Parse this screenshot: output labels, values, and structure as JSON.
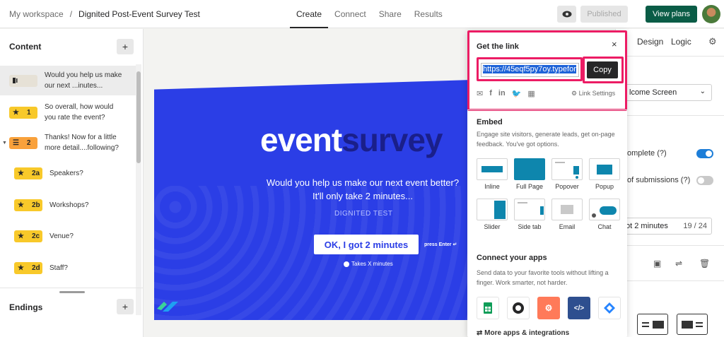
{
  "topbar": {
    "workspace": "My workspace",
    "separator": "/",
    "form_title": "Dignited Post-Event Survey Test",
    "tabs": [
      "Create",
      "Connect",
      "Share",
      "Results"
    ],
    "published_label": "Published",
    "view_plans_label": "View plans",
    "brand_color": "#0a5c46"
  },
  "sidebar": {
    "content_heading": "Content",
    "endings_heading": "Endings",
    "add_label": "+",
    "questions": [
      {
        "badge": "",
        "type": "welcome",
        "text": "Would you help us make our next ...inutes..."
      },
      {
        "badge": "1",
        "type": "star",
        "text": "So overall, how would you rate the event?"
      },
      {
        "badge": "2",
        "type": "group",
        "text": "Thanks! Now for a little more detail....following?"
      },
      {
        "badge": "2a",
        "type": "star",
        "text": "Speakers?"
      },
      {
        "badge": "2b",
        "type": "star",
        "text": "Workshops?"
      },
      {
        "badge": "2c",
        "type": "star",
        "text": "Venue?"
      },
      {
        "badge": "2d",
        "type": "star",
        "text": "Staff?"
      }
    ]
  },
  "canvas": {
    "logo_word1": "event",
    "logo_word2": "survey",
    "question_line1": "Would you help us make our next event better?",
    "question_line2": "It'll only take 2 minutes...",
    "subtitle": "DIGNITED TEST",
    "button_label": "OK, I got 2 minutes",
    "press_enter": "press Enter ↵",
    "takes_time": "Takes X minutes",
    "background_color": "#2b3ee6"
  },
  "right_panel": {
    "tab_design": "Design",
    "tab_logic": "Logic",
    "select_value": "lcome Screen",
    "toggle1_label": "omplete (?)",
    "toggle2_label": "of submissions (?)",
    "field_value": "ot 2 minutes",
    "field_count": "19 / 24"
  },
  "popover": {
    "title": "Get the link",
    "close": "×",
    "link_value": "https://45eqf5py7oy.typefor",
    "copy_label": "Copy",
    "link_settings": "Link Settings",
    "embed_title": "Embed",
    "embed_desc": "Engage site visitors, generate leads, get on-page feedback. You've got options.",
    "embed_options": [
      "Inline",
      "Full Page",
      "Popover",
      "Popup",
      "Slider",
      "Side tab",
      "Email",
      "Chat"
    ],
    "apps_title": "Connect your apps",
    "apps_desc": "Send data to your favorite tools without lifting a finger. Work smarter, not harder.",
    "apps": [
      "google-sheets-icon",
      "mailchimp-icon",
      "hubspot-icon",
      "embed-code-icon",
      "jira-icon"
    ],
    "more_apps": "More apps & integrations",
    "highlight_color": "#ec1c64"
  }
}
